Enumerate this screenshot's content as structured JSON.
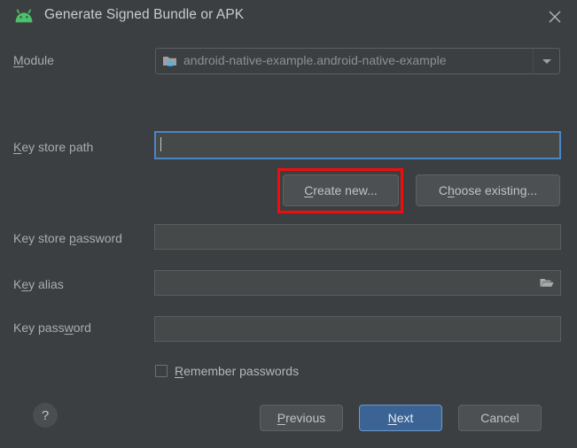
{
  "window": {
    "title": "Generate Signed Bundle or APK",
    "app_icon": "android-robot-icon",
    "close_icon": "close-icon"
  },
  "module": {
    "label": "Module",
    "mnemonic": "M",
    "label_rest": "odule",
    "value": "android-native-example.android-native-example",
    "icon": "module-folder-icon",
    "dropdown_icon": "chevron-down-icon"
  },
  "key_store_path": {
    "label_mn": "K",
    "label_rest": "ey store path",
    "value": "",
    "focused": true
  },
  "buttons": {
    "create_new_mn": "C",
    "create_new_rest": "reate new...",
    "choose_existing_pre": "C",
    "choose_existing_mn": "h",
    "choose_existing_rest": "oose existing...",
    "previous_mn": "P",
    "previous_rest": "revious",
    "next_mn": "N",
    "next_rest": "ext",
    "cancel": "Cancel"
  },
  "key_store_password": {
    "label_pre": "Key store ",
    "label_mn": "p",
    "label_rest": "assword",
    "value": ""
  },
  "key_alias": {
    "label_pre": "K",
    "label_mn": "e",
    "label_rest": "y alias",
    "value": "",
    "browse_icon": "folder-open-icon"
  },
  "key_password": {
    "label_pre": "Key pass",
    "label_mn": "w",
    "label_rest": "ord",
    "value": ""
  },
  "remember_passwords": {
    "label_mn": "R",
    "label_rest": "emember passwords",
    "checked": false
  },
  "help": {
    "glyph": "?"
  },
  "colors": {
    "background": "#3c3f41",
    "field_background": "#45494a",
    "field_border": "#5a5e60",
    "focus_border": "#4b87c4",
    "primary_button": "#3b6394",
    "annotation_red": "#f20d0d",
    "android_green": "#4ac16a",
    "text": "#bbbbbb"
  }
}
